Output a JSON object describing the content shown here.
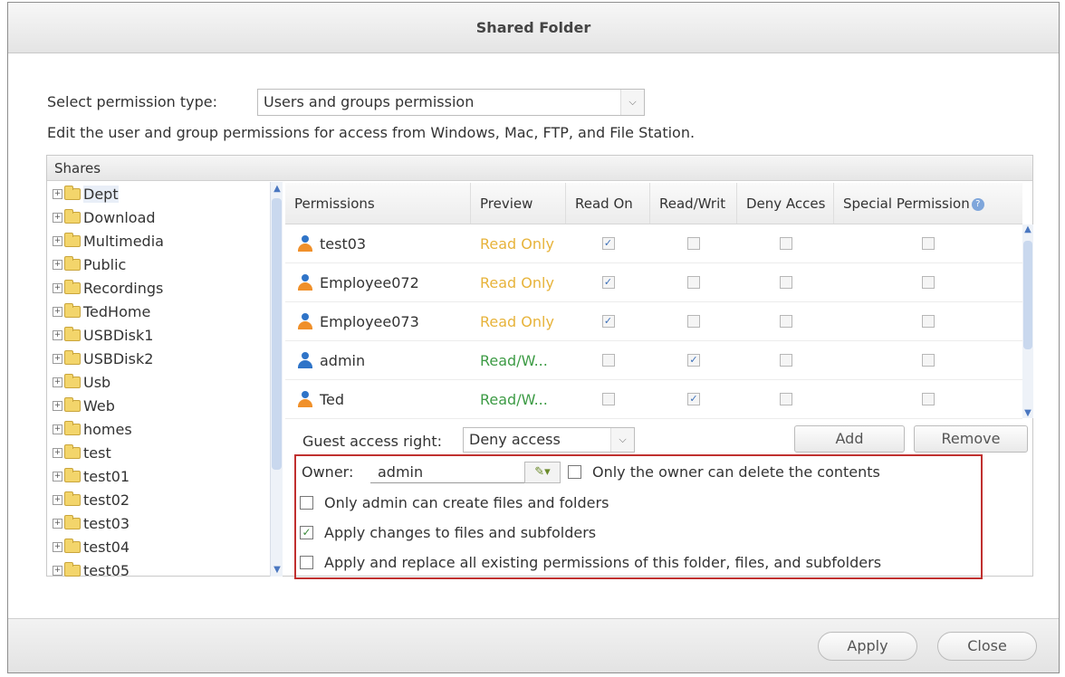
{
  "dialog": {
    "title": "Shared Folder"
  },
  "permission_type": {
    "label": "Select permission type:",
    "selected": "Users and groups permission"
  },
  "description": "Edit the user and group permissions for access from Windows, Mac, FTP, and File Station.",
  "shares": {
    "header": "Shares",
    "folders": [
      "Dept",
      "Download",
      "Multimedia",
      "Public",
      "Recordings",
      "TedHome",
      "USBDisk1",
      "USBDisk2",
      "Usb",
      "Web",
      "homes",
      "test",
      "test01",
      "test02",
      "test03",
      "test04",
      "test05"
    ],
    "selected": "Dept"
  },
  "permissions_table": {
    "columns": [
      "Permissions",
      "Preview",
      "Read On",
      "Read/Writ",
      "Deny Acces",
      "Special Permission"
    ],
    "rows": [
      {
        "name": "test03",
        "preview": "Read Only",
        "preview_type": "ro",
        "read_only": true,
        "read_write": false,
        "deny": false,
        "special": false,
        "icon": "user-icon"
      },
      {
        "name": "Employee072",
        "preview": "Read Only",
        "preview_type": "ro",
        "read_only": true,
        "read_write": false,
        "deny": false,
        "special": false,
        "icon": "user-icon"
      },
      {
        "name": "Employee073",
        "preview": "Read Only",
        "preview_type": "ro",
        "read_only": true,
        "read_write": false,
        "deny": false,
        "special": false,
        "icon": "user-icon"
      },
      {
        "name": "admin",
        "preview": "Read/W...",
        "preview_type": "rw",
        "read_only": false,
        "read_write": true,
        "deny": false,
        "special": false,
        "icon": "admin-user-icon"
      },
      {
        "name": "Ted",
        "preview": "Read/W...",
        "preview_type": "rw",
        "read_only": false,
        "read_write": true,
        "deny": false,
        "special": false,
        "icon": "user-icon"
      }
    ]
  },
  "guest_access": {
    "label": "Guest access right:",
    "selected": "Deny access"
  },
  "buttons": {
    "add": "Add",
    "remove": "Remove",
    "apply": "Apply",
    "close": "Close"
  },
  "owner": {
    "label": "Owner:",
    "value": "admin",
    "only_owner_delete": {
      "label": "Only the owner can delete the contents",
      "checked": false
    },
    "only_admin_create": {
      "label": "Only admin can create files and folders",
      "checked": false
    },
    "apply_changes": {
      "label": "Apply changes to files and subfolders",
      "checked": true
    },
    "apply_replace": {
      "label": "Apply and replace all existing permissions of this folder, files, and subfolders",
      "checked": false
    }
  },
  "colors": {
    "highlight_border": "#c0302f",
    "read_only": "#e7b33a",
    "read_write": "#3d9b45"
  }
}
